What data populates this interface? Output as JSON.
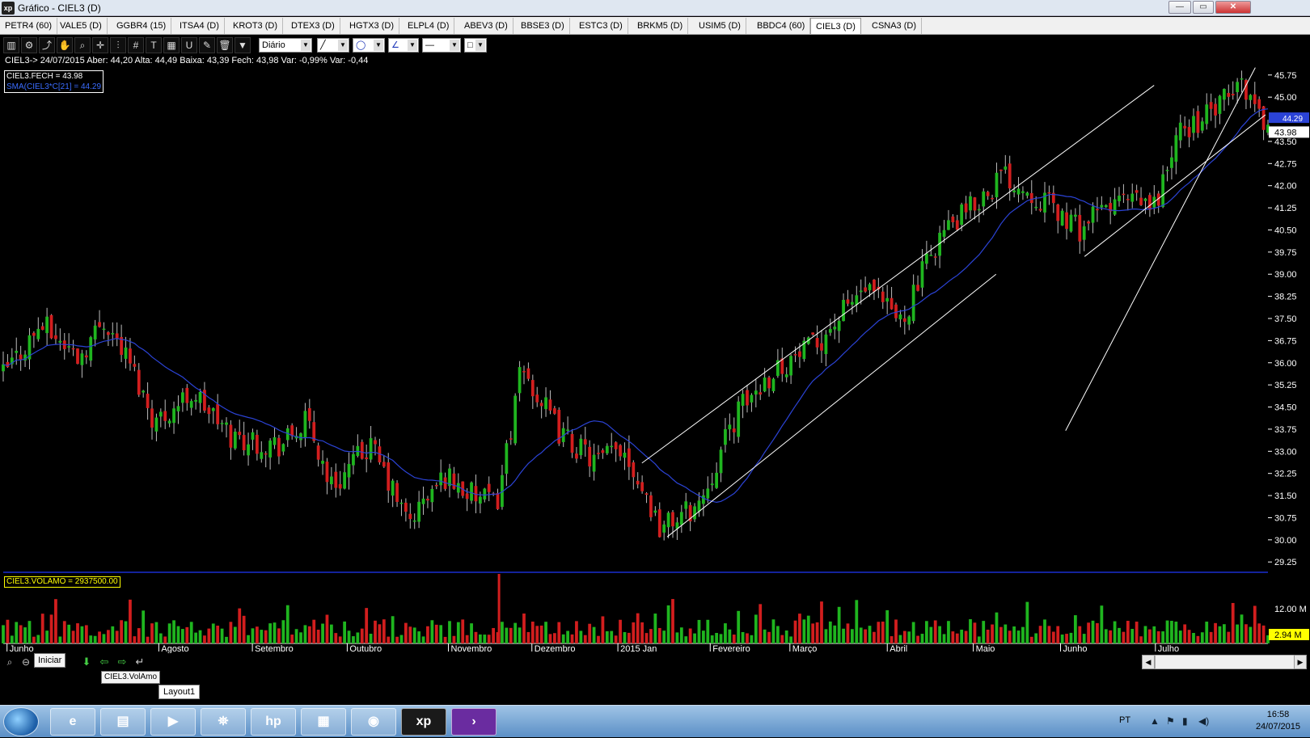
{
  "window": {
    "title": "Gráfico - CIEL3 (D)",
    "app_icon_text": "xp",
    "minimize_label": "—",
    "maximize_label": "▭",
    "close_label": "✕"
  },
  "tabs": [
    {
      "label": "PETR4 (60)"
    },
    {
      "label": "VALE5 (D)"
    },
    {
      "label": "GGBR4 (15)"
    },
    {
      "label": "ITSA4 (D)"
    },
    {
      "label": "KROT3 (D)"
    },
    {
      "label": "DTEX3 (D)"
    },
    {
      "label": "HGTX3 (D)"
    },
    {
      "label": "ELPL4 (D)"
    },
    {
      "label": "ABEV3 (D)"
    },
    {
      "label": "BBSE3 (D)"
    },
    {
      "label": "ESTC3 (D)"
    },
    {
      "label": "BRKM5 (D)"
    },
    {
      "label": "USIM5 (D)"
    },
    {
      "label": "BBDC4 (60)"
    },
    {
      "label": "CIEL3 (D)",
      "active": true
    },
    {
      "label": "CSNA3 (D)"
    }
  ],
  "toolbar": {
    "period_value": "Diário",
    "icons": [
      "chart-icon",
      "gear-icon",
      "trend-icon",
      "hand-icon",
      "zoom-icon",
      "crosshair-icon",
      "fibo-icon",
      "grid-icon",
      "text-icon",
      "table-icon",
      "magnet-icon",
      "brush-icon",
      "trash-icon",
      "filter-icon"
    ]
  },
  "info": {
    "line": "CIEL3-> 24/07/2015 Aber: 44,20 Alta: 44,49 Baixa: 43,39 Fech: 43,98 Var: -0,99% Var: -0,44",
    "legend_close": "CIEL3.FECH = 43.98",
    "legend_sma": "SMA(CIEL3*C[21] = 44.29",
    "vol_legend": "CIEL3.VOLAMO = 2937500.00"
  },
  "price_axis": {
    "ticks": [
      "45.75",
      "45.00",
      "43.50",
      "42.75",
      "42.00",
      "41.25",
      "40.50",
      "39.75",
      "39.00",
      "38.25",
      "37.50",
      "36.75",
      "36.00",
      "35.25",
      "34.50",
      "33.75",
      "33.00",
      "32.25",
      "31.50",
      "30.75",
      "30.00",
      "29.25"
    ],
    "last_close_label": "43.98",
    "sma_label": "44.29"
  },
  "volume_axis": {
    "tick_label": "12.00 M",
    "current_label": "2.94 M"
  },
  "time_axis": {
    "labels": [
      "Junho",
      "Agosto",
      "Setembro",
      "Outubro",
      "Novembro",
      "Dezembro",
      "2015 Jan",
      "Fevereiro",
      "Março",
      "Abril",
      "Maio",
      "Junho",
      "Julho"
    ]
  },
  "bottom": {
    "iniciar_tooltip": "Iniciar",
    "vol_tooltip": "CIEL3.VolAmo",
    "layout_tab": "Layout1"
  },
  "taskbar": {
    "language": "PT",
    "time": "16:58",
    "date": "24/07/2015"
  },
  "colors": {
    "up_candle": "#1fb51f",
    "down_candle": "#d21e1e",
    "sma_line": "#2b43d6",
    "channel_line": "#ffffff",
    "volume_separator": "#1a2fd0"
  },
  "chart_data": {
    "type": "candlestick",
    "ylim": [
      28.9,
      46.1
    ],
    "close_anchors": [
      {
        "x": 0,
        "y": 35.6
      },
      {
        "x": 0.03,
        "y": 37.3
      },
      {
        "x": 0.06,
        "y": 36.2
      },
      {
        "x": 0.08,
        "y": 37.5
      },
      {
        "x": 0.1,
        "y": 36.0
      },
      {
        "x": 0.12,
        "y": 34.0
      },
      {
        "x": 0.15,
        "y": 35.0
      },
      {
        "x": 0.18,
        "y": 33.5
      },
      {
        "x": 0.22,
        "y": 33.2
      },
      {
        "x": 0.24,
        "y": 34.0
      },
      {
        "x": 0.26,
        "y": 31.8
      },
      {
        "x": 0.29,
        "y": 33.2
      },
      {
        "x": 0.32,
        "y": 30.6
      },
      {
        "x": 0.35,
        "y": 32.2
      },
      {
        "x": 0.37,
        "y": 31.5
      },
      {
        "x": 0.39,
        "y": 31.2
      },
      {
        "x": 0.41,
        "y": 35.8
      },
      {
        "x": 0.44,
        "y": 33.6
      },
      {
        "x": 0.47,
        "y": 32.6
      },
      {
        "x": 0.49,
        "y": 33.2
      },
      {
        "x": 0.52,
        "y": 30.4
      },
      {
        "x": 0.55,
        "y": 31.2
      },
      {
        "x": 0.58,
        "y": 34.3
      },
      {
        "x": 0.61,
        "y": 35.8
      },
      {
        "x": 0.64,
        "y": 36.5
      },
      {
        "x": 0.68,
        "y": 38.5
      },
      {
        "x": 0.71,
        "y": 37.4
      },
      {
        "x": 0.74,
        "y": 40.3
      },
      {
        "x": 0.76,
        "y": 41.0
      },
      {
        "x": 0.79,
        "y": 42.4
      },
      {
        "x": 0.82,
        "y": 41.6
      },
      {
        "x": 0.85,
        "y": 40.5
      },
      {
        "x": 0.88,
        "y": 41.5
      },
      {
        "x": 0.91,
        "y": 41.3
      },
      {
        "x": 0.93,
        "y": 43.8
      },
      {
        "x": 0.96,
        "y": 44.6
      },
      {
        "x": 0.98,
        "y": 45.5
      },
      {
        "x": 1.0,
        "y": 43.98
      }
    ],
    "channel_lines": [
      {
        "x1": 0.505,
        "y1": 32.6,
        "x2": 0.91,
        "y2": 45.4
      },
      {
        "x1": 0.525,
        "y1": 30.1,
        "x2": 0.785,
        "y2": 39.0
      },
      {
        "x1": 0.855,
        "y1": 39.6,
        "x2": 0.998,
        "y2": 44.4
      },
      {
        "x1": 0.84,
        "y1": 33.7,
        "x2": 0.99,
        "y2": 46.0
      }
    ]
  }
}
